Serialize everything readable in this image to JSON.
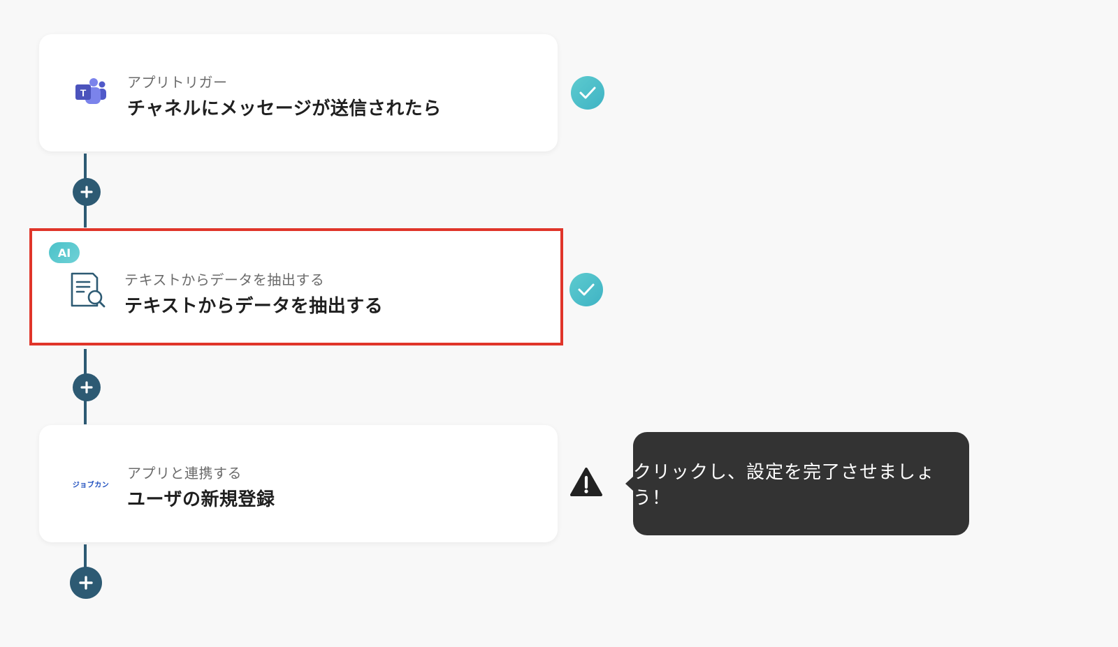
{
  "steps": [
    {
      "subtitle": "アプリトリガー",
      "title": "チャネルにメッセージが送信されたら",
      "icon": "teams-icon",
      "status": "complete"
    },
    {
      "badge": "AI",
      "subtitle": "テキストからデータを抽出する",
      "title": "テキストからデータを抽出する",
      "icon": "document-search-icon",
      "status": "complete"
    },
    {
      "subtitle": "アプリと連携する",
      "title": "ユーザの新規登録",
      "icon_text": "ジョブカン",
      "icon": "jobcan-logo",
      "status": "warning"
    }
  ],
  "tooltip": {
    "text": "クリックし、設定を完了させましょう！"
  },
  "colors": {
    "connector": "#2d5a73",
    "check": "#4bbfca",
    "selected_border": "#e0352a",
    "tooltip_bg": "#333333",
    "jobcan_blue": "#1f4fbf"
  }
}
